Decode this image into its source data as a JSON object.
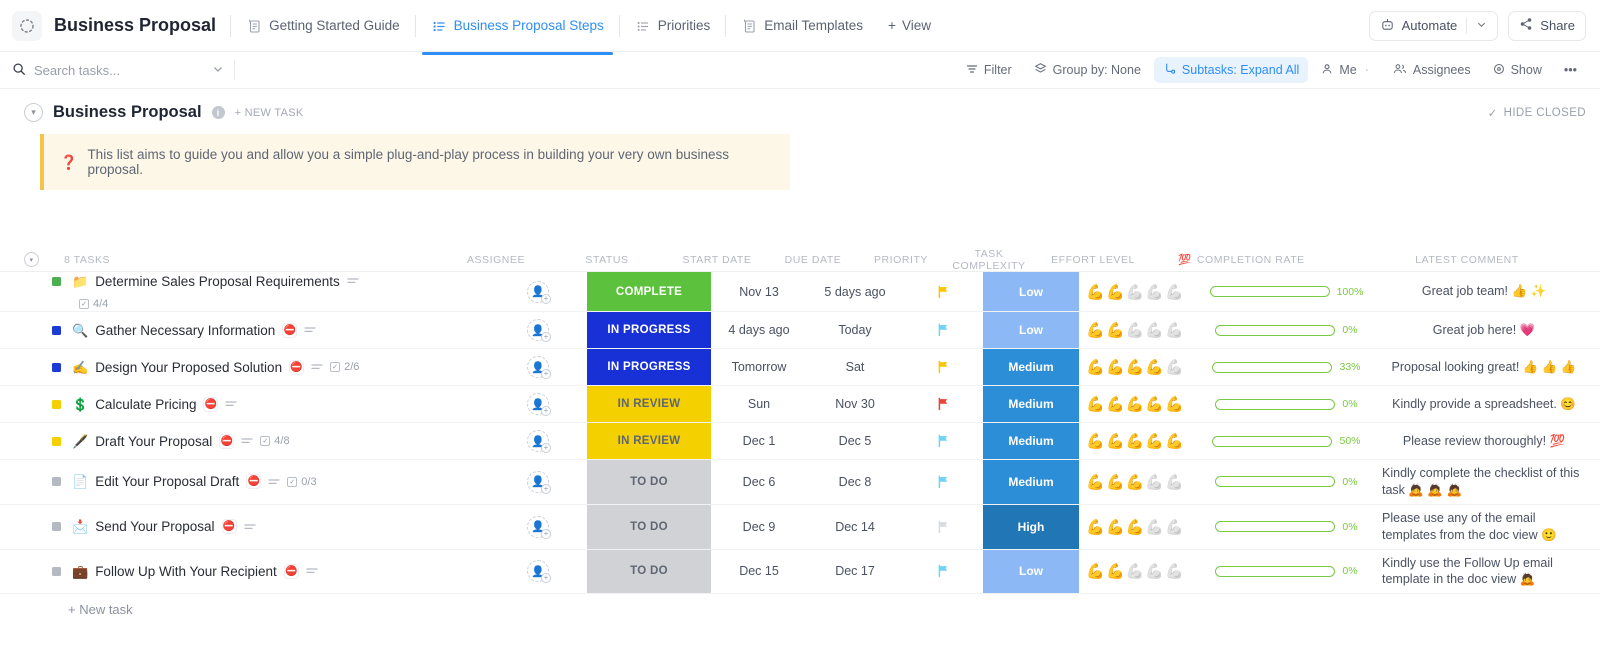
{
  "header": {
    "app_title": "Business Proposal",
    "app_icon": "dots-circle-icon",
    "tabs": [
      {
        "label": "Getting Started Guide",
        "icon": "doc-icon",
        "active": false
      },
      {
        "label": "Business Proposal Steps",
        "icon": "list-icon",
        "active": true
      },
      {
        "label": "Priorities",
        "icon": "list-icon",
        "active": false
      },
      {
        "label": "Email Templates",
        "icon": "doc-icon",
        "active": false
      }
    ],
    "add_view_label": "View",
    "automate_label": "Automate",
    "share_label": "Share",
    "accent_color": "#2f8ef4"
  },
  "toolbar": {
    "search_placeholder": "Search tasks...",
    "search_value": "",
    "filter_label": "Filter",
    "group_by_label": "Group by: None",
    "subtasks_label": "Subtasks: Expand All",
    "me_label": "Me",
    "assignees_label": "Assignees",
    "show_label": "Show",
    "more_label": "•••"
  },
  "list": {
    "title": "Business Proposal",
    "new_task_label": "+ NEW TASK",
    "hide_closed_label": "HIDE CLOSED",
    "callout": "This list aims to guide you and allow you a simple plug-and-play process in building your very own business proposal.",
    "task_count_label": "8 TASKS",
    "footer_new_task": "+ New task"
  },
  "columns": {
    "assignee": "ASSIGNEE",
    "status": "STATUS",
    "start_date": "START DATE",
    "due_date": "DUE DATE",
    "priority": "PRIORITY",
    "task_complexity": "TASK COMPLEXITY",
    "effort_level": "EFFORT LEVEL",
    "completion_rate": "COMPLETION RATE",
    "completion_rate_emoji": "💯",
    "latest_comment": "LATEST COMMENT"
  },
  "tasks": [
    {
      "name": "Determine Sales Proposal Requirements",
      "emoji": "📁",
      "square_color": "#4caf50",
      "priority_badge": "",
      "has_description": true,
      "subtasks": "4/4",
      "status": "COMPLETE",
      "status_color": "#5cc13d",
      "start_date": "Nov 13",
      "due_date": "5 days ago",
      "due_date_style": "green",
      "priority_flag_color": "#fdc400",
      "complexity": "Low",
      "complexity_color": "#8cb9f5",
      "effort_filled": 2,
      "completion": 100,
      "comment": "Great job team! 👍 ✨"
    },
    {
      "name": "Gather Necessary Information",
      "emoji": "🔍",
      "square_color": "#1b3bd4",
      "priority_badge": "⛔",
      "has_description": true,
      "subtasks": "",
      "status": "IN PROGRESS",
      "status_color": "#1831d6",
      "start_date": "4 days ago",
      "due_date": "Today",
      "due_date_style": "orange",
      "priority_flag_color": "#6fd3f5",
      "complexity": "Low",
      "complexity_color": "#8cb9f5",
      "effort_filled": 2,
      "completion": 0,
      "comment": "Great job here! 💗"
    },
    {
      "name": "Design Your Proposed Solution",
      "emoji": "✍️",
      "square_color": "#1b3bd4",
      "priority_badge": "⛔",
      "has_description": true,
      "subtasks": "2/6",
      "status": "IN PROGRESS",
      "status_color": "#1831d6",
      "start_date": "Tomorrow",
      "due_date": "Sat",
      "due_date_style": "",
      "priority_flag_color": "#fdc400",
      "complexity": "Medium",
      "complexity_color": "#2c8ed6",
      "effort_filled": 4,
      "completion": 33,
      "comment": "Proposal looking great! 👍 👍 👍"
    },
    {
      "name": "Calculate Pricing",
      "emoji": "💲",
      "square_color": "#f5d000",
      "priority_badge": "⛔",
      "has_description": true,
      "subtasks": "",
      "status": "IN REVIEW",
      "status_color": "#f5d000",
      "start_date": "Sun",
      "due_date": "Nov 30",
      "due_date_style": "",
      "priority_flag_color": "#e8443a",
      "complexity": "Medium",
      "complexity_color": "#2c8ed6",
      "effort_filled": 5,
      "completion": 0,
      "comment": "Kindly provide a spreadsheet. 😊"
    },
    {
      "name": "Draft Your Proposal",
      "emoji": "🖋️",
      "square_color": "#f5d000",
      "priority_badge": "⛔",
      "has_description": true,
      "subtasks": "4/8",
      "status": "IN REVIEW",
      "status_color": "#f5d000",
      "start_date": "Dec 1",
      "due_date": "Dec 5",
      "due_date_style": "",
      "priority_flag_color": "#6fd3f5",
      "complexity": "Medium",
      "complexity_color": "#2c8ed6",
      "effort_filled": 5,
      "completion": 50,
      "comment": "Please review thoroughly! 💯"
    },
    {
      "name": "Edit Your Proposal Draft",
      "emoji": "📄",
      "square_color": "#b5bac2",
      "priority_badge": "⛔",
      "has_description": true,
      "subtasks": "0/3",
      "status": "TO DO",
      "status_color": "#d0d2d6",
      "start_date": "Dec 6",
      "due_date": "Dec 8",
      "due_date_style": "",
      "priority_flag_color": "#6fd3f5",
      "complexity": "Medium",
      "complexity_color": "#2c8ed6",
      "effort_filled": 3,
      "completion": 0,
      "comment": "Kindly complete the checklist of this task 🙇 🙇 🙇"
    },
    {
      "name": "Send Your Proposal",
      "emoji": "📩",
      "square_color": "#b5bac2",
      "priority_badge": "⛔",
      "has_description": true,
      "subtasks": "",
      "status": "TO DO",
      "status_color": "#d0d2d6",
      "start_date": "Dec 9",
      "due_date": "Dec 14",
      "due_date_style": "",
      "priority_flag_color": "#d7dade",
      "complexity": "High",
      "complexity_color": "#2176b5",
      "effort_filled": 3,
      "completion": 0,
      "comment": "Please use any of the email templates from the doc view 🙂"
    },
    {
      "name": "Follow Up With Your Recipient",
      "emoji": "💼",
      "square_color": "#b5bac2",
      "priority_badge": "⛔",
      "has_description": true,
      "subtasks": "",
      "status": "TO DO",
      "status_color": "#d0d2d6",
      "start_date": "Dec 15",
      "due_date": "Dec 17",
      "due_date_style": "",
      "priority_flag_color": "#6fd3f5",
      "complexity": "Low",
      "complexity_color": "#8cb9f5",
      "effort_filled": 2,
      "completion": 0,
      "comment": "Kindly use the Follow Up email template in the doc view 🙇"
    }
  ]
}
